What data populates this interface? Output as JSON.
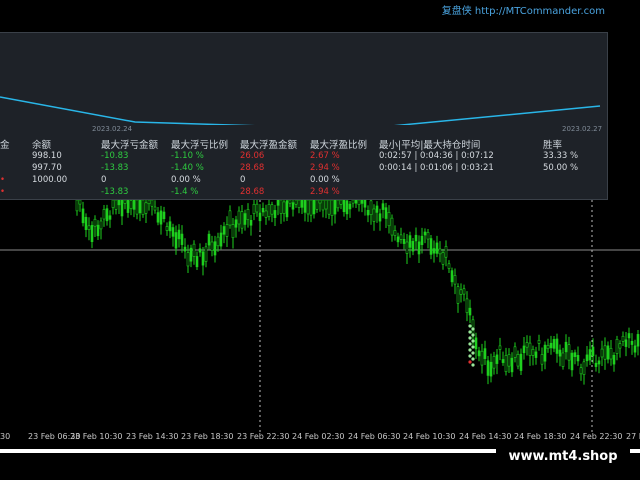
{
  "header": {
    "brand": "复盘侠 http://MTCommander.com"
  },
  "panel": {
    "date_start": "2023.02.24",
    "date_end": "2023.02.27",
    "columns": [
      "金",
      "余额",
      "最大浮亏金额",
      "最大浮亏比例",
      "最大浮盈金额",
      "最大浮盈比例",
      "最小|平均|最大持仓时间",
      "胜率"
    ],
    "rows": [
      {
        "balance": "998.10",
        "loss_amt": "-10.83",
        "loss_pct": "-1.10 %",
        "gain_amt": "26.06",
        "gain_pct": "2.67 %",
        "hold": "0:02:57 | 0:04:36 | 0:07:12",
        "winrate": "33.33 %"
      },
      {
        "balance": "997.70",
        "loss_amt": "-13.83",
        "loss_pct": "-1.40 %",
        "gain_amt": "28.68",
        "gain_pct": "2.94 %",
        "hold": "0:00:14 | 0:01:06 | 0:03:21",
        "winrate": "50.00 %"
      },
      {
        "balance": "1000.00",
        "loss_amt": "0",
        "loss_pct": "0.00 %",
        "gain_amt": "0",
        "gain_pct": "0.00 %",
        "hold": "",
        "winrate": ""
      },
      {
        "balance": "",
        "loss_amt": "-13.83",
        "loss_pct": "-1.4 %",
        "gain_amt": "28.68",
        "gain_pct": "2.94 %",
        "hold": "",
        "winrate": ""
      }
    ]
  },
  "time_axis": [
    "30",
    "23 Feb 06:30",
    "23 Feb 10:30",
    "23 Feb 14:30",
    "23 Feb 18:30",
    "23 Feb 22:30",
    "24 Feb 02:30",
    "24 Feb 06:30",
    "24 Feb 10:30",
    "24 Feb 14:30",
    "24 Feb 18:30",
    "24 Feb 22:30",
    "27 Fe"
  ],
  "watermark": "www.mt4.shop",
  "colors": {
    "bull": "#1ecf1e",
    "line": "#29b6e8",
    "panel_bg": "#1e2228",
    "loss": "#2ecc40",
    "gain": "#e03030"
  }
}
